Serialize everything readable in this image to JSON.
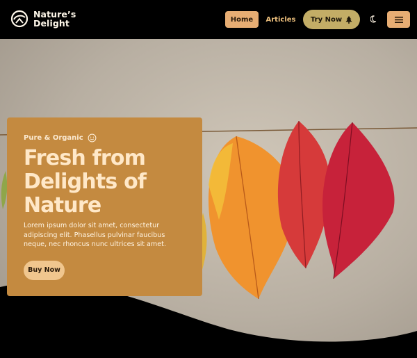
{
  "brand": {
    "name_line1": "Nature’s",
    "name_line2": "Delight",
    "logo_icon": "leaf-circle-icon"
  },
  "nav": {
    "home": "Home",
    "articles": "Articles",
    "try_now": "Try Now",
    "try_now_icon": "tree-icon",
    "theme_icon": "moon-icon",
    "menu_icon": "hamburger-icon"
  },
  "hero": {
    "eyebrow": "Pure & Organic",
    "eyebrow_icon": "smile-icon",
    "headline_line1": "Fresh from",
    "headline_line2": "Delights of",
    "headline_line3": "Nature",
    "body": "Lorem ipsum dolor sit amet, consectetur adipiscing elit. Phasellus pulvinar faucibus neque, nec rhoncus nunc ultrices sit amet.",
    "cta": "Buy Now"
  },
  "colors": {
    "accent": "#e7ad73",
    "card": "#c48a40",
    "try_now": "#c3ad66",
    "header_bg": "#000000"
  }
}
